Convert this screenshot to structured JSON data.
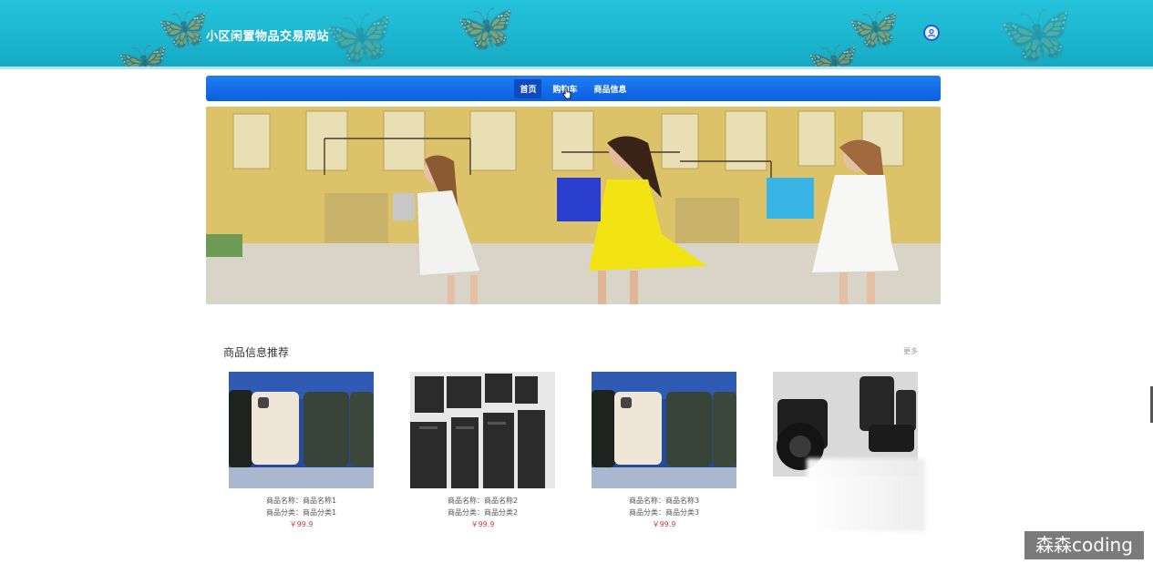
{
  "header": {
    "site_title": "小区闲置物品交易网站",
    "user_icon": "user-circle-icon"
  },
  "nav": {
    "items": [
      {
        "label": "首页",
        "active": true
      },
      {
        "label": "购物车",
        "active": false
      },
      {
        "label": "商品信息",
        "active": false
      }
    ]
  },
  "banner": {
    "description": "shopping-women-banner"
  },
  "recommend": {
    "title": "商品信息推荐",
    "more": "更多",
    "products": [
      {
        "name_label": "商品名称：商品名称1",
        "category_label": "商品分类：商品分类1",
        "price": "￥99.9",
        "image": "iphone"
      },
      {
        "name_label": "商品名称：商品名称2",
        "category_label": "商品分类：商品分类2",
        "price": "￥99.9",
        "image": "computers"
      },
      {
        "name_label": "商品名称：商品名称3",
        "category_label": "商品分类：商品分类3",
        "price": "￥99.9",
        "image": "iphone"
      },
      {
        "name_label": "",
        "category_label": "",
        "price": "",
        "image": "camera"
      }
    ]
  },
  "watermark": "森森coding",
  "colors": {
    "header_bg": "#1ab3cc",
    "nav_bg": "#0b5fe0",
    "price": "#e03a3a"
  }
}
